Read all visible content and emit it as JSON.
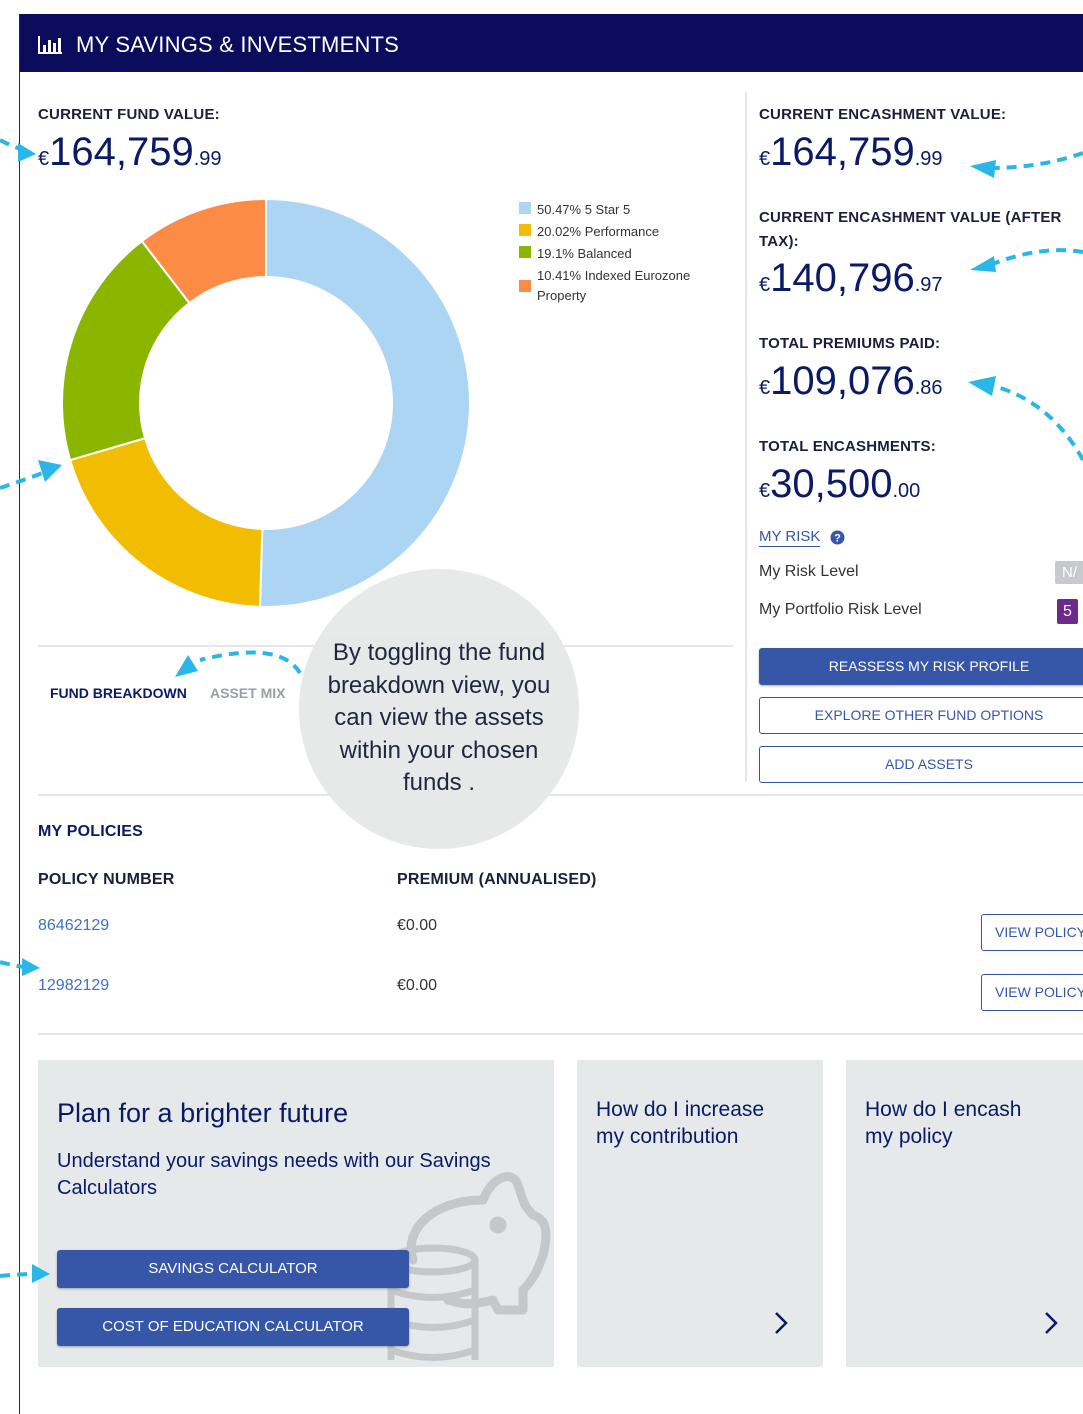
{
  "header": {
    "title": "MY SAVINGS & INVESTMENTS",
    "icon": "bar-chart-icon"
  },
  "fund_value": {
    "label": "CURRENT FUND VALUE:",
    "currency": "€",
    "whole": "164,759",
    "decimal": ".99"
  },
  "chart_data": {
    "type": "pie",
    "donut": true,
    "categories": [
      "5 Star 5",
      "Performance",
      "Balanced",
      "Indexed Eurozone Property"
    ],
    "values": [
      50.47,
      20.02,
      19.1,
      10.41
    ],
    "colors": [
      "#acd5f3",
      "#f2bd00",
      "#8ab600",
      "#fb8b45"
    ],
    "legend": [
      "50.47% 5 Star 5",
      "20.02% Performance",
      "19.1% Balanced",
      "10.41% Indexed Eurozone Property"
    ],
    "legend_placement": "top-right"
  },
  "tabs": {
    "fund_breakdown": "FUND BREAKDOWN",
    "asset_mix": "ASSET MIX"
  },
  "tooltip": {
    "text_lines": [
      "By toggling the fund",
      "breakdown view, you",
      "can view the assets",
      "within your chosen",
      "funds ."
    ]
  },
  "right": {
    "encash_label": "CURRENT ENCASHMENT VALUE:",
    "encash": {
      "currency": "€",
      "whole": "164,759",
      "decimal": ".99"
    },
    "encash_tax_label_1": "CURRENT ENCASHMENT VALUE (AFTER",
    "encash_tax_label_2": "TAX):",
    "encash_tax": {
      "currency": "€",
      "whole": "140,796",
      "decimal": ".97"
    },
    "premiums_label": "TOTAL PREMIUMS PAID:",
    "premiums": {
      "currency": "€",
      "whole": "109,076",
      "decimal": ".86"
    },
    "encashments_label": "TOTAL ENCASHMENTS:",
    "encashments": {
      "currency": "€",
      "whole": "30,500",
      "decimal": ".00"
    },
    "risk_link": "MY RISK",
    "risk_level_label": "My Risk Level",
    "risk_level_value": "N/",
    "portfolio_risk_label": "My Portfolio Risk Level",
    "portfolio_risk_value": "5",
    "btn_reassess": "REASSESS MY RISK PROFILE",
    "btn_explore": "EXPLORE OTHER FUND OPTIONS",
    "btn_add": "ADD ASSETS"
  },
  "policies": {
    "title": "MY POLICIES",
    "col_number": "POLICY NUMBER",
    "col_premium": "PREMIUM (ANNUALISED)",
    "rows": [
      {
        "number": "86462129",
        "premium": "€0.00",
        "button": "VIEW POLICY"
      },
      {
        "number": "12982129",
        "premium": "€0.00",
        "button": "VIEW POLICY"
      }
    ]
  },
  "cards": {
    "plan": {
      "title": "Plan for a brighter future",
      "sub1": "Understand your savings needs with our Savings",
      "sub2": "Calculators",
      "btn_savings": "SAVINGS CALCULATOR",
      "btn_education": "COST OF EDUCATION CALCULATOR"
    },
    "increase": {
      "line1": "How do I increase",
      "line2": "my contribution"
    },
    "encash": {
      "line1": "How do I encash",
      "line2": "my policy"
    }
  }
}
